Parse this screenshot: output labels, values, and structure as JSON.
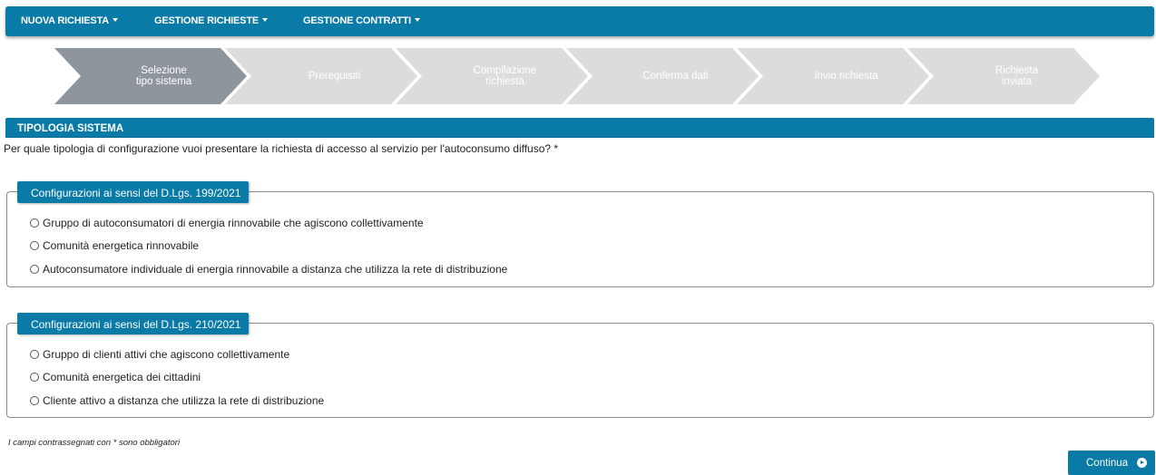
{
  "nav": {
    "items": [
      {
        "label": "NUOVA RICHIESTA"
      },
      {
        "label": "GESTIONE RICHIESTE"
      },
      {
        "label": "GESTIONE CONTRATTI"
      }
    ]
  },
  "steps": {
    "active_color": "#8f959c",
    "inactive_color": "#dcdcdc",
    "items": [
      {
        "label": "Selezione\ntipo sistema",
        "active": true
      },
      {
        "label": "Prerequisiti",
        "active": false
      },
      {
        "label": "Compilazione\nrichiesta",
        "active": false
      },
      {
        "label": "Conferma dati",
        "active": false
      },
      {
        "label": "Invio richiesta",
        "active": false
      },
      {
        "label": "Richiesta\ninviata",
        "active": false
      }
    ]
  },
  "section": {
    "title": "TIPOLOGIA SISTEMA",
    "question": "Per quale tipologia di configurazione vuoi presentare la richiesta di accesso al servizio per l'autoconsumo diffuso? *"
  },
  "groups": [
    {
      "legend": "Configurazioni ai sensi del D.Lgs. 199/2021",
      "options": [
        "Gruppo di autoconsumatori di energia rinnovabile che agiscono collettivamente",
        "Comunità energetica rinnovabile",
        "Autoconsumatore individuale di energia rinnovabile a distanza che utilizza la rete di distribuzione"
      ]
    },
    {
      "legend": "Configurazioni ai sensi del D.Lgs. 210/2021",
      "options": [
        "Gruppo di clienti attivi che agiscono collettivamente",
        "Comunità energetica dei cittadini",
        "Cliente attivo a distanza che utilizza la rete di distribuzione"
      ]
    }
  ],
  "footer": {
    "note": "I campi contrassegnati con * sono obbligatori",
    "continue_label": "Continua"
  },
  "colors": {
    "brand": "#0a7aa6"
  }
}
